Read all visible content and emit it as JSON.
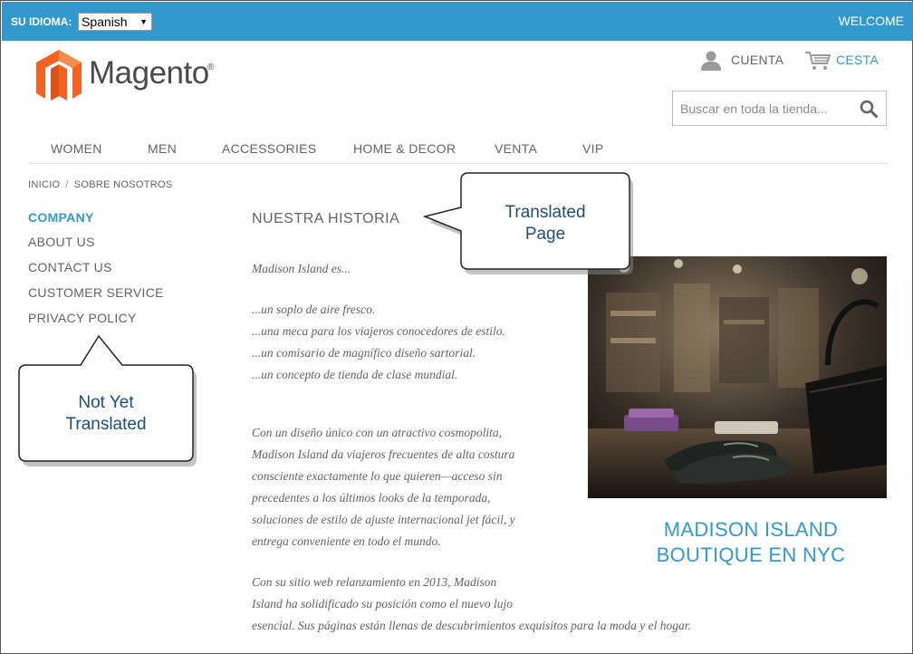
{
  "topbar": {
    "language_label": "SU IDIOMA:",
    "language_selected": "Spanish",
    "welcome": "WELCOME",
    "color": "#3399cc"
  },
  "logo": {
    "name": "Magento",
    "trademark": "®"
  },
  "header": {
    "account_label": "CUENTA",
    "cart_label": "CESTA",
    "search_placeholder": "Buscar en toda la tienda..."
  },
  "nav": {
    "items": [
      {
        "label": "WOMEN"
      },
      {
        "label": "MEN"
      },
      {
        "label": "ACCESSORIES"
      },
      {
        "label": "HOME & DECOR"
      },
      {
        "label": "VENTA"
      },
      {
        "label": "VIP"
      }
    ]
  },
  "breadcrumb": {
    "home": "INICIO",
    "separator": "/",
    "current": "SOBRE NOSOTROS"
  },
  "sidebar": {
    "title": "COMPANY",
    "items": [
      {
        "label": "ABOUT US"
      },
      {
        "label": "CONTACT US"
      },
      {
        "label": "CUSTOMER SERVICE"
      },
      {
        "label": "PRIVACY POLICY"
      }
    ]
  },
  "main": {
    "title": "NUESTRA HISTORIA",
    "intro": "Madison Island es...",
    "lines": [
      "...un soplo de aire fresco.",
      "...una meca para los viajeros conocedores de estilo.",
      "...un comisario de magnífico diseño sartorial.",
      "...un concepto de tienda de clase mundial."
    ],
    "paragraph1": [
      "Con un diseño único con un atractivo cosmopolita,",
      "Madison Island da viajeros frecuentes de alta costura",
      "consciente exactamente lo que quieren—acceso sin",
      "precedentes a los últimos looks de la temporada,",
      "soluciones de estilo de ajuste internacional jet fácil, y",
      "entrega conveniente en todo el mundo."
    ],
    "paragraph2": [
      "Con su sitio web relanzamiento en 2013, Madison",
      "Island ha solidificado su posición como el nuevo lujo",
      "esencial. Sus páginas están llenas de descubrimientos exquisitos para la moda y el hogar."
    ],
    "caption_line1": "MADISON ISLAND",
    "caption_line2": "BOUTIQUE EN NYC"
  },
  "callouts": {
    "translated": [
      "Translated",
      "Page"
    ],
    "not_translated": [
      "Not Yet",
      "Translated"
    ]
  }
}
